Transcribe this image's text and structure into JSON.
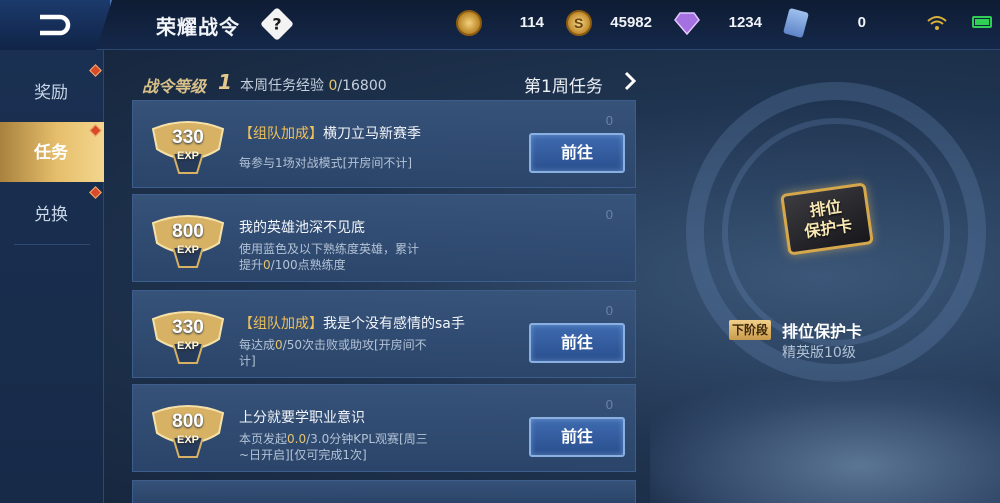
{
  "header": {
    "title": "荣耀战令",
    "help_label": "?",
    "resources": [
      {
        "name": "battle-pass-token",
        "value": "114",
        "color": "#d4a640"
      },
      {
        "name": "gold-coin",
        "value": "45982",
        "color": "#d9a23e"
      },
      {
        "name": "diamond",
        "value": "1234",
        "color": "#a874e0"
      },
      {
        "name": "voucher",
        "value": "0",
        "color": "#7fa6e0"
      }
    ]
  },
  "sidebar": {
    "items": [
      {
        "label": "奖励",
        "active": false
      },
      {
        "label": "任务",
        "active": true
      },
      {
        "label": "兑换",
        "active": false
      }
    ]
  },
  "level": {
    "label": "战令等级",
    "value": "1",
    "exp_prefix": "本周任务经验 ",
    "exp_current": "0",
    "exp_total": "/16800"
  },
  "week": {
    "title": "第1周任务"
  },
  "tasks": [
    {
      "exp": "330",
      "exp_unit": "EXP",
      "tag": "【组队加成】",
      "title": "横刀立马新赛季",
      "desc": "每参与1场对战模式[开房间不计]",
      "count": "0",
      "button": "前往"
    },
    {
      "exp": "800",
      "exp_unit": "EXP",
      "tag": "",
      "title": "我的英雄池深不见底",
      "desc_line1": "使用蓝色及以下熟练度英雄，累计",
      "desc_line2_prefix": "提升",
      "desc_line2_hl": "0",
      "desc_line2_suffix": "/100点熟练度",
      "count": "0"
    },
    {
      "exp": "330",
      "exp_unit": "EXP",
      "tag": "【组队加成】",
      "title": "我是个没有感情的sa手",
      "desc_prefix": "每达成",
      "desc_hl": "0",
      "desc_suffix": "/50次击败或助攻[开房间不",
      "desc_line2": "计]",
      "count": "0",
      "button": "前往"
    },
    {
      "exp": "800",
      "exp_unit": "EXP",
      "tag": "",
      "title": "上分就要学职业意识",
      "desc_prefix": "本页发起",
      "desc_hl": "0.0",
      "desc_suffix": "/3.0分钟KPL观赛[周三",
      "desc_line2": "~日开启][仅可完成1次]",
      "count": "0",
      "button": "前往"
    }
  ],
  "preview": {
    "card_text_line1": "排位",
    "card_text_line2": "保护卡",
    "next_tag": "下阶段",
    "next_name": "排位保护卡",
    "next_sub": "精英版10级"
  }
}
